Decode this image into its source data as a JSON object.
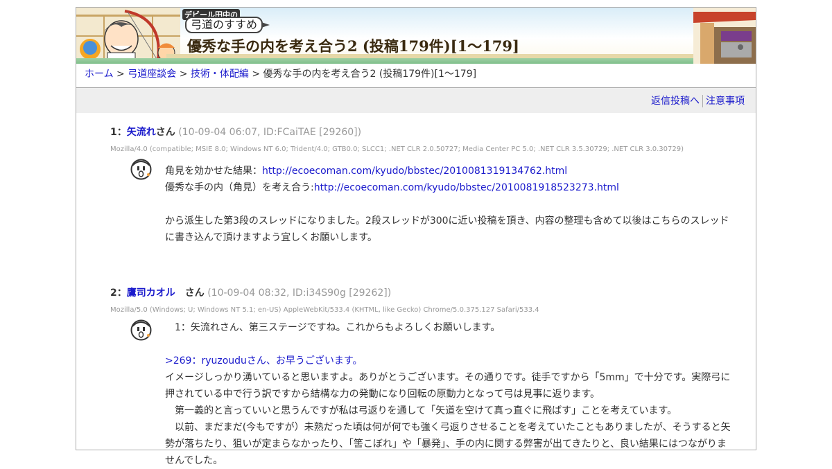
{
  "header": {
    "logo_small": "デビール田中の",
    "logo_main": "弓道のすすめ",
    "thread_title": "優秀な手の内を考え合う2 (投稿179件)[1～179]"
  },
  "breadcrumb": {
    "items": [
      "ホーム",
      "弓道座談会",
      "技術・体配編"
    ],
    "separator": ">",
    "current": "優秀な手の内を考え合う2 (投稿179件)[1～179]"
  },
  "actions": {
    "reply": "返信投稿へ",
    "notes": "注意事項"
  },
  "posts": [
    {
      "num": "1：",
      "author": "矢流れ",
      "san": "さん",
      "meta": "(10-09-04 06:07, ID:FCaiTAE [29260])",
      "ua": "Mozilla/4.0 (compatible; MSIE 8.0; Windows NT 6.0; Trident/4.0; GTB0.0; SLCC1; .NET CLR 2.0.50727; Media Center PC 5.0; .NET CLR 3.5.30729; .NET CLR 3.0.30729)",
      "line1_text": "角見を効かせた結果：",
      "line1_link": "http://ecoecoman.com/kyudo/bbstec/2010081319134762.html",
      "line2_text": "優秀な手の内（角見）を考え合う:",
      "line2_link": "http://ecoecoman.com/kyudo/bbstec/2010081918523273.html",
      "line3": "から派生した第3段のスレッドになりました。2段スレッドが300に近い投稿を頂き、内容の整理も含めて以後はこちらのスレッド",
      "line4": "に書き込んで頂けますよう宜しくお願いします。"
    },
    {
      "num": "2：",
      "author": "鷹司カオル　",
      "san": "さん",
      "meta": "(10-09-04 08:32, ID:i34S90g [29262])",
      "ua": "Mozilla/5.0 (Windows; U; Windows NT 5.1; en-US) AppleWebKit/533.4 (KHTML, like Gecko) Chrome/5.0.375.127 Safari/533.4",
      "line1": "　1：矢流れさん、第三ステージですね。これからもよろしくお願いします。",
      "reply": ">269：ryuzouduさん、お早うございます。",
      "line2": "イメージしっかり湧いていると思いますよ。ありがとうございます。その通りです。徒手ですから「5mm」で十分です。実際弓に",
      "line3": "押されている中で行う訳ですから結構な力の発動になり回転の原動力となって弓は見事に返ります。",
      "line4": "　第一義的と言っていいと思うんですが私は弓返りを通して「矢道を空けて真っ直ぐに飛ばす」ことを考えています。",
      "line5": "　以前、まだまだ(今もですが）未熟だった頃は何が何でも強く弓返りさせることを考えていたこともありましたが、そうすると矢",
      "line6": "勢が落ちたり、狙いが定まらなかったり、「筈こぼれ」や「暴発」、手の内に関する弊害が出てきたりと、良い結果にはつながりませんでした。"
    }
  ],
  "colors": {
    "link": "#1a1acc",
    "meta": "#999999",
    "text": "#333333",
    "actionbar_bg": "#eeeeee"
  }
}
